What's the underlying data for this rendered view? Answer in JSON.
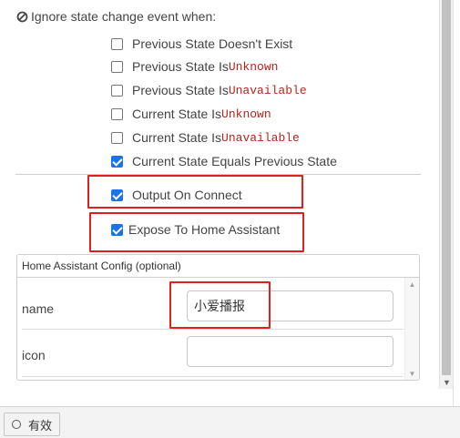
{
  "ignore_section": {
    "icon": "ban-icon",
    "heading": "Ignore state change event when:",
    "options": [
      {
        "prefix": "Previous State Doesn't Exist",
        "code": "",
        "checked": false
      },
      {
        "prefix": "Previous State Is ",
        "code": "Unknown",
        "checked": false
      },
      {
        "prefix": "Previous State Is ",
        "code": "Unavailable",
        "checked": false
      },
      {
        "prefix": "Current State Is ",
        "code": "Unknown",
        "checked": false
      },
      {
        "prefix": "Current State Is ",
        "code": "Unavailable",
        "checked": false
      },
      {
        "prefix": "Current State Equals Previous State",
        "code": "",
        "checked": true
      }
    ]
  },
  "output_on_connect": {
    "label": "Output On Connect",
    "checked": true
  },
  "expose_to_ha": {
    "label": "Expose To Home Assistant",
    "checked": true
  },
  "ha_config": {
    "title": "Home Assistant Config (optional)",
    "fields": [
      {
        "label": "name",
        "value": "小爱播报",
        "placeholder": ""
      },
      {
        "label": "icon",
        "value": "",
        "placeholder": ""
      }
    ]
  },
  "footer": {
    "status_label": "有效",
    "status_icon": "circle-icon"
  },
  "colors": {
    "accent": "#1a73e8",
    "highlight": "#e02020",
    "code": "#b5251d"
  }
}
